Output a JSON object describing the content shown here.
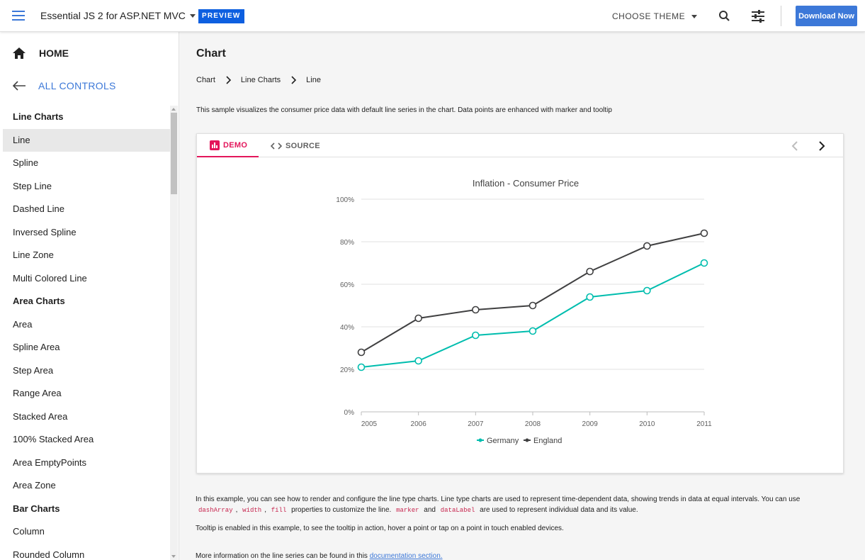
{
  "header": {
    "product": "Essential JS 2 for ASP.NET MVC",
    "badge": "PREVIEW",
    "choose_theme": "CHOOSE THEME",
    "download": "Download Now",
    "accent": "#3c78d8"
  },
  "sidebar": {
    "home": "HOME",
    "all_controls": "ALL CONTROLS",
    "items": [
      {
        "label": "Line Charts",
        "kind": "group"
      },
      {
        "label": "Line",
        "kind": "item",
        "active": true
      },
      {
        "label": "Spline",
        "kind": "item"
      },
      {
        "label": "Step Line",
        "kind": "item"
      },
      {
        "label": "Dashed Line",
        "kind": "item"
      },
      {
        "label": "Inversed Spline",
        "kind": "item"
      },
      {
        "label": "Line Zone",
        "kind": "item"
      },
      {
        "label": "Multi Colored Line",
        "kind": "item"
      },
      {
        "label": "Area Charts",
        "kind": "group"
      },
      {
        "label": "Area",
        "kind": "item"
      },
      {
        "label": "Spline Area",
        "kind": "item"
      },
      {
        "label": "Step Area",
        "kind": "item"
      },
      {
        "label": "Range Area",
        "kind": "item"
      },
      {
        "label": "Stacked Area",
        "kind": "item"
      },
      {
        "label": "100% Stacked Area",
        "kind": "item"
      },
      {
        "label": "Area EmptyPoints",
        "kind": "item"
      },
      {
        "label": "Area Zone",
        "kind": "item"
      },
      {
        "label": "Bar Charts",
        "kind": "group"
      },
      {
        "label": "Column",
        "kind": "item"
      },
      {
        "label": "Rounded Column",
        "kind": "item"
      }
    ]
  },
  "main": {
    "title": "Chart",
    "breadcrumb": [
      "Chart",
      "Line Charts",
      "Line"
    ],
    "description": "This sample visualizes the consumer price data with default line series in the chart. Data points are enhanced with marker and tooltip",
    "tabs": {
      "demo": "DEMO",
      "source": "SOURCE"
    },
    "info": {
      "p1_start": "In this example, you can see how to render and configure the line type charts. Line type charts are used to represent time-dependent data, showing trends in data at equal intervals. You can use",
      "code1": "dashArray",
      "sep1": ",",
      "code2": "width",
      "sep2": ",",
      "code3": "fill",
      "mid": "properties to customize the line.",
      "code4": "marker",
      "and": "and",
      "code5": "dataLabel",
      "p1_end": "are used to represent individual data and its value.",
      "p2": "Tooltip is enabled in this example, to see the tooltip in action, hover a point or tap on a point in touch enabled devices.",
      "p3_start": "More information on the line series can be found in this",
      "p3_link": "documentation section."
    }
  },
  "chart_data": {
    "type": "line",
    "title": "Inflation - Consumer Price",
    "categories": [
      "2005",
      "2006",
      "2007",
      "2008",
      "2009",
      "2010",
      "2011"
    ],
    "series": [
      {
        "name": "Germany",
        "values": [
          21,
          24,
          36,
          38,
          54,
          57,
          70
        ],
        "color": "#00bdae"
      },
      {
        "name": "England",
        "values": [
          28,
          44,
          48,
          50,
          66,
          78,
          84
        ],
        "color": "#404041"
      }
    ],
    "ylim": [
      0,
      100
    ],
    "yticks": [
      "0%",
      "20%",
      "40%",
      "60%",
      "80%",
      "100%"
    ],
    "ytick_values": [
      0,
      20,
      40,
      60,
      80,
      100
    ],
    "grid": true,
    "legend_position": "bottom"
  }
}
